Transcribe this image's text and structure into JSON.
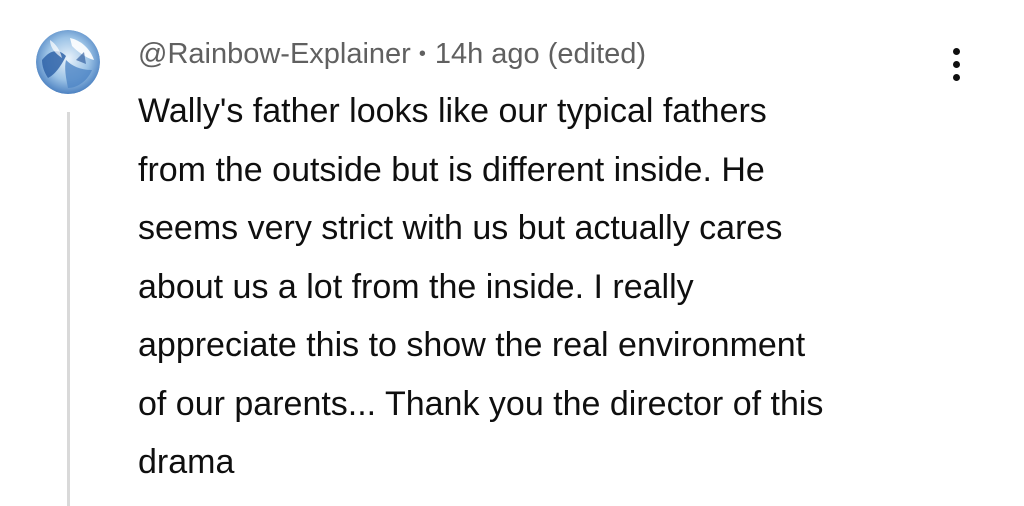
{
  "comment": {
    "author": "@Rainbow-Explainer",
    "separator": "•",
    "timestamp": "14h ago",
    "edited_label": "(edited)",
    "avatar_icon": "avatar-image",
    "menu_icon": "more-vert-icon",
    "body_lines": [
      "Wally's father looks like our typical fathers",
      "from the outside but is different inside. He",
      "seems very strict with us but actually cares",
      "about us a lot from the inside. I really",
      "appreciate this to show the real environment",
      "of our parents... Thank you the director of this",
      "drama"
    ]
  },
  "colors": {
    "text_primary": "#0f0f0f",
    "text_secondary": "#606060",
    "thread_line": "#d9d9d9",
    "avatar_blue": "#3b73b9"
  }
}
